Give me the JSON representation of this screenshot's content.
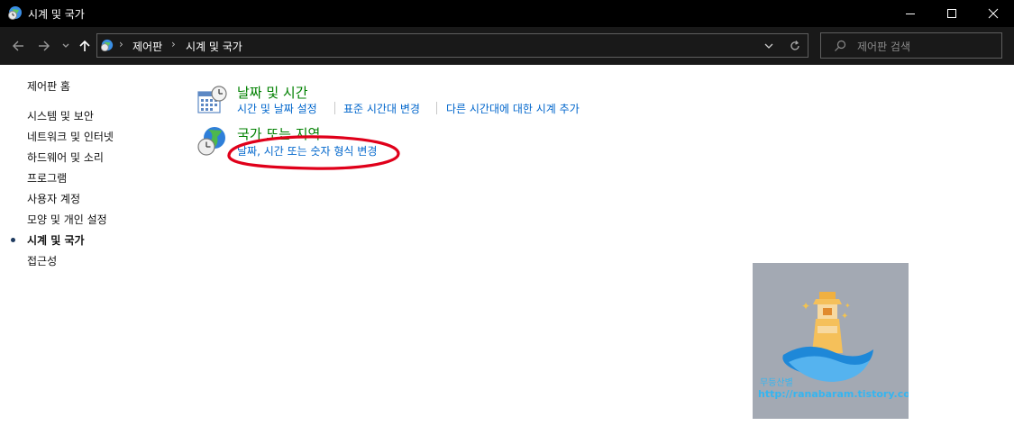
{
  "window": {
    "title": "시계 및 국가",
    "icon": "clock-globe-icon"
  },
  "address_bar": {
    "breadcrumb": [
      "제어판",
      "시계 및 국가"
    ],
    "search_placeholder": "제어판 검색"
  },
  "sidebar": {
    "items": [
      {
        "label": "제어판 홈",
        "active": false
      },
      {
        "label": "시스템 및 보안",
        "active": false
      },
      {
        "label": "네트워크 및 인터넷",
        "active": false
      },
      {
        "label": "하드웨어 및 소리",
        "active": false
      },
      {
        "label": "프로그램",
        "active": false
      },
      {
        "label": "사용자 계정",
        "active": false
      },
      {
        "label": "모양 및 개인 설정",
        "active": false
      },
      {
        "label": "시계 및 국가",
        "active": true
      },
      {
        "label": "접근성",
        "active": false
      }
    ]
  },
  "categories": [
    {
      "title": "날짜 및 시간",
      "icon": "calendar-clock-icon",
      "links": [
        "시간 및 날짜 설정",
        "표준 시간대 변경",
        "다른 시간대에 대한 시계 추가"
      ]
    },
    {
      "title": "국가 또는 지역",
      "icon": "globe-clock-icon",
      "links": [
        "날짜, 시간 또는 숫자 형식 변경"
      ]
    }
  ],
  "annotation": {
    "color": "#e0001a"
  },
  "watermark": {
    "name": "무등산별",
    "url": "http://ranabaram.tistory.com"
  },
  "colors": {
    "category_title": "#008000",
    "link": "#0066cc",
    "titlebar": "#000000"
  }
}
